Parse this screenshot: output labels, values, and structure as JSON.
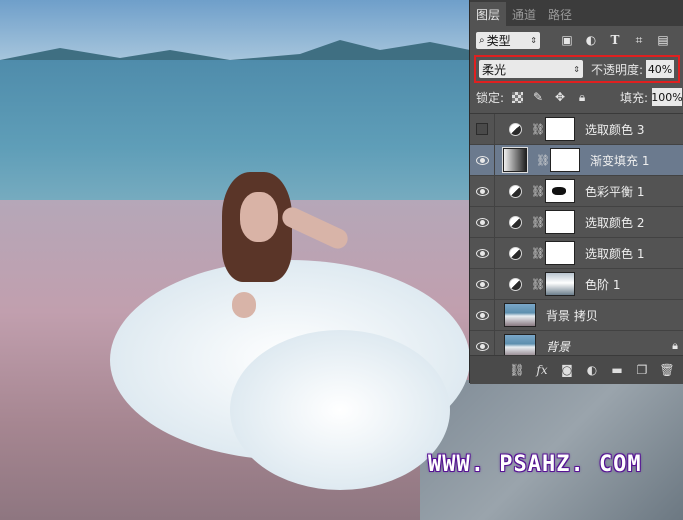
{
  "watermark": "WWW. PSAHZ. COM",
  "panel": {
    "tabs": [
      "图层",
      "通道",
      "路径"
    ],
    "active_tab": 0,
    "filter": {
      "kind_label": "类型",
      "icons": [
        "image-filter-icon",
        "adjustment-filter-icon",
        "type-filter-icon",
        "shape-filter-icon",
        "smart-object-filter-icon"
      ]
    },
    "blend_mode": "柔光",
    "opacity_label": "不透明度:",
    "opacity_value": "40%",
    "lock_label": "锁定:",
    "fill_label": "填充:",
    "fill_value": "100%",
    "layers": [
      {
        "name": "选取颜色 3",
        "visible": false,
        "type": "adjustment",
        "mask": "white"
      },
      {
        "name": "渐变填充 1",
        "visible": true,
        "type": "gradient",
        "mask": "white",
        "selected": true
      },
      {
        "name": "色彩平衡 1",
        "visible": true,
        "type": "adjustment",
        "mask": "dark"
      },
      {
        "name": "选取颜色 2",
        "visible": true,
        "type": "adjustment",
        "mask": "white"
      },
      {
        "name": "选取颜色 1",
        "visible": true,
        "type": "adjustment",
        "mask": "white"
      },
      {
        "name": "色阶 1",
        "visible": true,
        "type": "levels",
        "mask": "levels"
      },
      {
        "name": "背景 拷贝",
        "visible": true,
        "type": "photo"
      },
      {
        "name": "背景",
        "visible": true,
        "type": "photo",
        "locked": true,
        "italic": true
      }
    ],
    "bottom_icons": [
      "link-layers-icon",
      "fx-icon",
      "add-mask-icon",
      "new-adjustment-icon",
      "new-group-icon",
      "new-layer-icon",
      "delete-icon"
    ]
  },
  "colors": {
    "panel_bg": "#535353",
    "selected_row": "#6b7a8e",
    "highlight_border": "#e02020",
    "watermark_outline": "#5c1599"
  }
}
